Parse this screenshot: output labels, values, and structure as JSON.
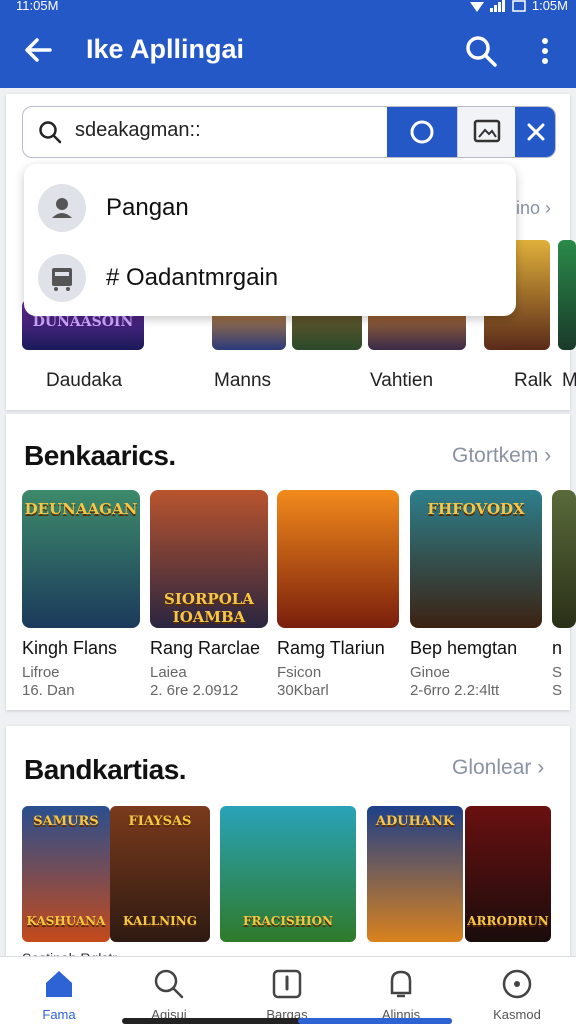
{
  "status_bar": {
    "time": "11:05M",
    "battery": "1:05M"
  },
  "app_bar": {
    "title": "Ike Apllingai"
  },
  "search": {
    "query": "sdeakagman::"
  },
  "suggestions": [
    {
      "label": "Pangan"
    },
    {
      "label": "# Oadantmrgain"
    }
  ],
  "top_row": {
    "see_more": "ino",
    "labels": [
      "Daudaka",
      "Manns",
      "Vahtien",
      "Ralk",
      "M"
    ]
  },
  "section1": {
    "title": "Benkaarics.",
    "see_more": "Gtortkem",
    "games": [
      {
        "name": "Kingh Flans",
        "line1": "Lifroe",
        "line2": "16. Dan",
        "art": "DEUNAAGAN",
        "colors": [
          "#3d8a6a",
          "#1b3a5c"
        ]
      },
      {
        "name": "Rang Rarclae",
        "line1": "Laiea",
        "line2": "2. 6re 2.0912",
        "art": "SIORPOLA IOAMBA",
        "colors": [
          "#b9542e",
          "#2a2540"
        ]
      },
      {
        "name": "Ramg Tlariun",
        "line1": "Fsicon",
        "line2": "30Kbarl",
        "art": "",
        "colors": [
          "#f28a1c",
          "#7a1f0c"
        ]
      },
      {
        "name": "Bep hemgtan",
        "line1": "Ginoe",
        "line2": "2-6rro 2.2:4ltt",
        "art": "FHFOVODX",
        "colors": [
          "#2d7f8c",
          "#3b2212"
        ]
      },
      {
        "name": "n",
        "line1": "S",
        "line2": "S",
        "art": "",
        "colors": [
          "#5a6a3a",
          "#2a3018"
        ]
      }
    ]
  },
  "section2": {
    "title": "Bandkartias.",
    "see_more": "Glonlear",
    "tiles": [
      {
        "art": "SAMURS",
        "art2": "KASHUANA",
        "colors": [
          "#2a4f8f",
          "#c44a1a"
        ]
      },
      {
        "art": "FIAYSAS",
        "art2": "KALLNING",
        "colors": [
          "#7a3a1c",
          "#2e1a12"
        ]
      },
      {
        "art": "",
        "art2": "FRACISHION",
        "colors": [
          "#29a3b8",
          "#2f7a2a"
        ]
      },
      {
        "art": "ADUHANK",
        "art2": "",
        "colors": [
          "#1e3f8a",
          "#d9821e"
        ]
      },
      {
        "art": "",
        "art2": "ARRODRUN",
        "colors": [
          "#6a1010",
          "#1a0c0c"
        ]
      }
    ],
    "under_labels": "Sastinab Rglstr"
  },
  "bottom_nav": [
    {
      "label": "Fama",
      "icon": "home-icon"
    },
    {
      "label": "Agisui",
      "icon": "search-icon"
    },
    {
      "label": "Bargas",
      "icon": "clipboard-icon"
    },
    {
      "label": "Alinnis",
      "icon": "bell-icon"
    },
    {
      "label": "Kasmod",
      "icon": "target-icon"
    }
  ],
  "colors": {
    "primary": "#2358c6",
    "active_nav": "#2e63d6"
  }
}
